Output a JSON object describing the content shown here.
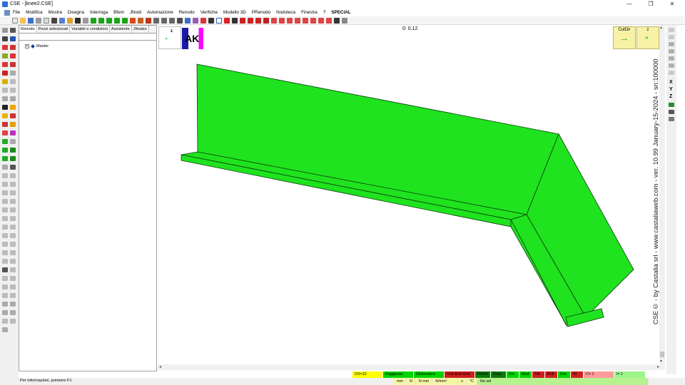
{
  "window": {
    "title": "CSE - [knee2.CSE]",
    "minimize": "—",
    "restore": "❐",
    "close": "✕"
  },
  "menu": [
    "File",
    "Modifica",
    "Mostra",
    "Disegna",
    "Interroga",
    "Bfem",
    "JNodi",
    "Automazione",
    "Renodo",
    "Verifiche",
    "Modello 3D",
    "PRenodo",
    "Nodoteca",
    "Finestra",
    "?",
    "SPECIAL"
  ],
  "panel": {
    "tabs": [
      "Renodo",
      "Pezzi selezionati",
      "Variabili e condizioni",
      "Assistente",
      "JNodes"
    ],
    "tree": {
      "expander": "+",
      "label": "Master"
    }
  },
  "viewport": {
    "axis_z": "z",
    "badge": "AK",
    "timer": "0: 0.12",
    "cutdir_label": "CutDir",
    "axis_box_z": "z",
    "watermark": "CSE© - by Castalia srl - www.castaliaweb.com - ver. 10.99 January-15-2024 - sn:100000",
    "model_fill": "#1ee31e",
    "model_stroke": "#0c3a0c"
  },
  "rightbar": {
    "x": "X",
    "y": "Y",
    "z": "Z"
  },
  "status": [
    {
      "label": "DS=10",
      "color": "#ffff00"
    },
    {
      "label": "Raggiusta",
      "color": "#00d400"
    },
    {
      "label": "Dislocatore",
      "color": "#00d400"
    },
    {
      "label": "Unit-Bolt-Grid",
      "color": "#d01f1f"
    },
    {
      "label": "Memb",
      "color": "#0a7a0a"
    },
    {
      "label": "Cmp",
      "color": "#0a7a0a"
    },
    {
      "label": "Fin",
      "color": "#00d400"
    },
    {
      "label": "Med",
      "color": "#00d400"
    },
    {
      "label": "Sld",
      "color": "#d01f1f"
    },
    {
      "label": "Bolt",
      "color": "#d01f1f"
    },
    {
      "label": "Crn",
      "color": "#00d400"
    },
    {
      "label": "Al",
      "color": "#d01f1f"
    },
    {
      "label": "C= 1",
      "color": "#ff9b9b"
    },
    {
      "label": "I= 1",
      "color": "#9cf58a"
    }
  ],
  "bottom": {
    "info": "Per informazioni, premere F1",
    "units": [
      "mm",
      "N",
      "N mm",
      "N/mm²",
      "s",
      "°C"
    ],
    "selection": "No sel"
  }
}
